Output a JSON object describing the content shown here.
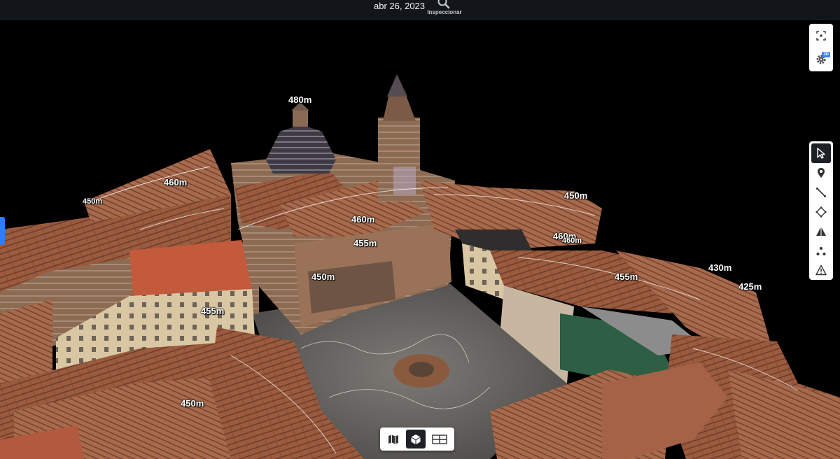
{
  "header": {
    "date": "abr 26, 2023",
    "inspect_label": "Inspeccionar"
  },
  "elevation_labels": [
    "480m",
    "460m",
    "455m",
    "450m",
    "460m",
    "455m",
    "450m",
    "450m",
    "460m",
    "430m",
    "425m",
    "455m",
    "450m",
    "460m"
  ],
  "side_controls": {
    "top": [
      {
        "icon": "focus-icon"
      },
      {
        "icon": "settings-3d-icon",
        "badge": "3D"
      }
    ],
    "tools": [
      {
        "icon": "cursor-icon",
        "active": true
      },
      {
        "icon": "location-pin-icon"
      },
      {
        "icon": "line-measure-icon"
      },
      {
        "icon": "area-polygon-icon"
      },
      {
        "icon": "volume-icon"
      },
      {
        "icon": "points-icon"
      },
      {
        "icon": "warning-icon"
      }
    ]
  },
  "view_modes": [
    {
      "icon": "map-icon",
      "active": false
    },
    {
      "icon": "3d-cube-icon",
      "active": true
    },
    {
      "icon": "split-view-icon",
      "active": false
    }
  ],
  "colors": {
    "accent": "#2f7df6",
    "topbar": "#12161b",
    "panel": "#ffffff",
    "active_tool": "#1d2126"
  }
}
